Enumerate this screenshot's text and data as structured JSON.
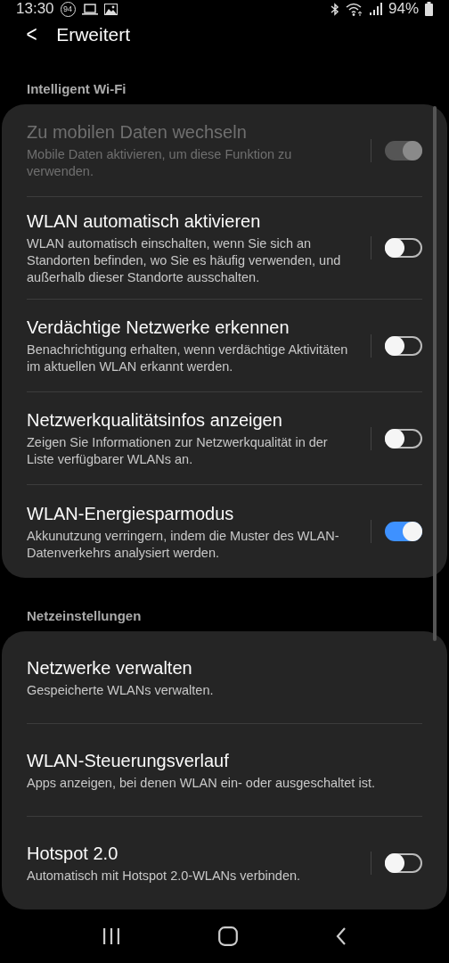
{
  "status_bar": {
    "time": "13:30",
    "badge": "94",
    "battery": "94%"
  },
  "header": {
    "back": "<",
    "title": "Erweitert"
  },
  "sections": [
    {
      "title": "Intelligent Wi-Fi",
      "items": [
        {
          "kind": "toggle",
          "title": "Zu mobilen Daten wechseln",
          "subtitle": "Mobile Daten aktivieren, um diese Funktion zu verwenden.",
          "on": true,
          "disabled": true
        },
        {
          "kind": "toggle",
          "title": "WLAN automatisch aktivieren",
          "subtitle": "WLAN automatisch einschalten, wenn Sie sich an Standorten befinden, wo Sie es häufig verwenden, und außerhalb dieser Standorte ausschalten.",
          "on": false,
          "disabled": false
        },
        {
          "kind": "toggle",
          "title": "Verdächtige Netzwerke erkennen",
          "subtitle": "Benachrichtigung erhalten, wenn verdächtige Aktivitäten im aktuellen WLAN erkannt werden.",
          "on": false,
          "disabled": false
        },
        {
          "kind": "toggle",
          "title": "Netzwerkqualitätsinfos anzeigen",
          "subtitle": "Zeigen Sie Informationen zur Netzwerkqualität in der Liste verfügbarer WLANs an.",
          "on": false,
          "disabled": false
        },
        {
          "kind": "toggle",
          "title": "WLAN-Energiesparmodus",
          "subtitle": "Akkunutzung verringern, indem die Muster des WLAN-Datenverkehrs analysiert werden.",
          "on": true,
          "disabled": false
        }
      ]
    },
    {
      "title": "Netzeinstellungen",
      "items": [
        {
          "kind": "link",
          "title": "Netzwerke verwalten",
          "subtitle": "Gespeicherte WLANs verwalten."
        },
        {
          "kind": "link",
          "title": "WLAN-Steuerungsverlauf",
          "subtitle": "Apps anzeigen, bei denen WLAN ein- oder ausgeschaltet ist."
        },
        {
          "kind": "toggle",
          "title": "Hotspot 2.0",
          "subtitle": "Automatisch mit Hotspot 2.0-WLANs verbinden.",
          "on": false,
          "disabled": false
        }
      ]
    }
  ]
}
